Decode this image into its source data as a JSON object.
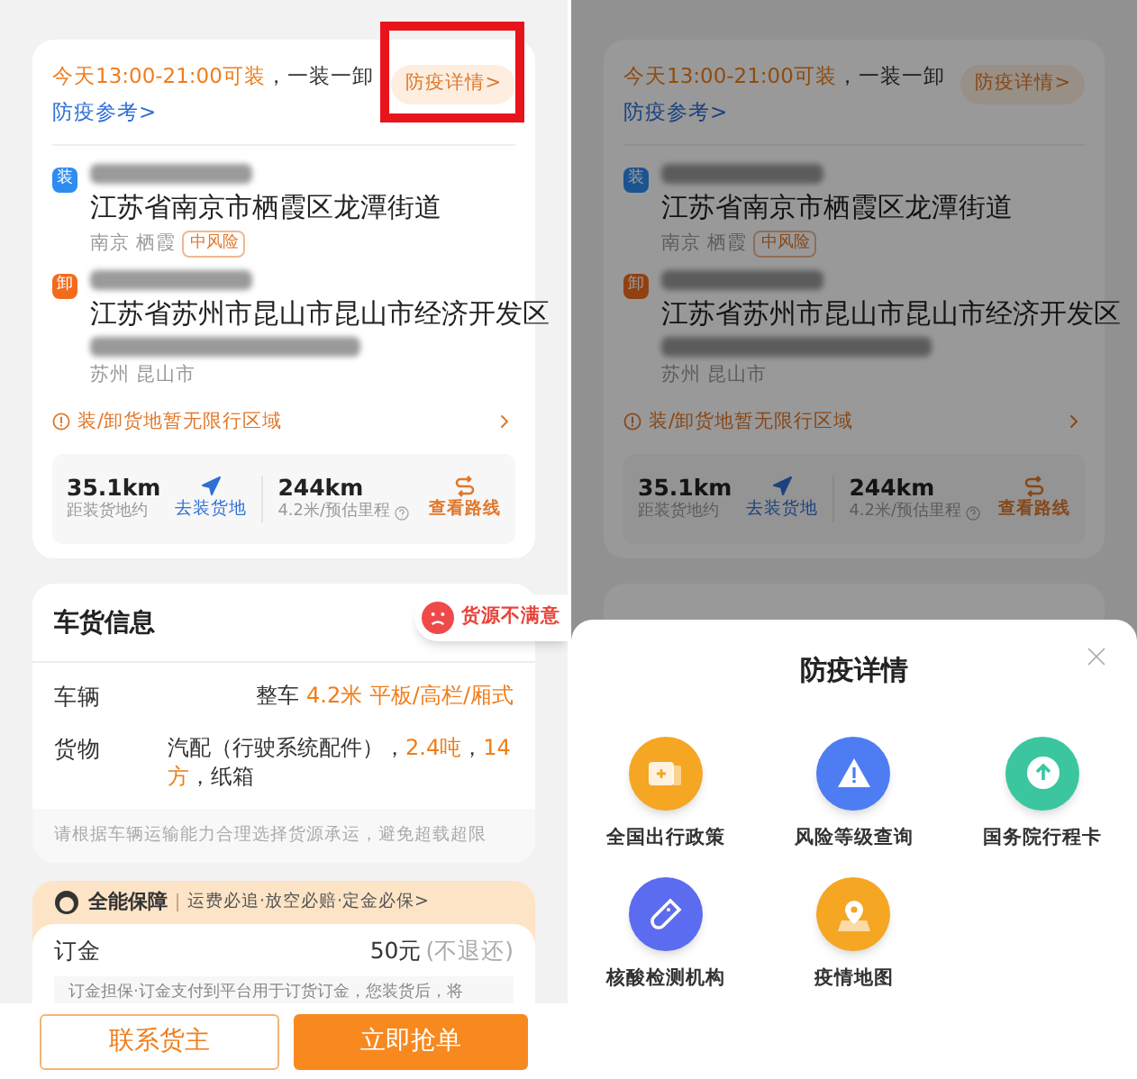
{
  "left_screen": {
    "dimmed": false,
    "header": {
      "time_text": "今天13:00-21:00可装",
      "plain_text": "，一装一卸 ",
      "link": "防疫参考>"
    },
    "epidemic_button": {
      "label": "防疫详情>",
      "highlighted": true
    },
    "stops": [
      {
        "kind": "load",
        "badge": "装",
        "address": "江苏省南京市栖霞区龙潭街道",
        "city": "南京 栖霞",
        "risk_tag": "中风险"
      },
      {
        "kind": "unload",
        "badge": "卸",
        "address": "江苏省苏州市昆山市昆山市经济开发区",
        "city": "苏州 昆山市"
      }
    ],
    "notice": "装/卸货地暂无限行区域",
    "stats": {
      "distance": "35.1km",
      "distance_label": "距装货地约",
      "nav_link": "去装货地",
      "mileage": "244km",
      "mileage_label": "4.2米/预估里程",
      "route_link": "查看路线"
    },
    "cargo": {
      "title": "车货信息",
      "feedback": "货源不满意",
      "rows": [
        {
          "label": "车辆",
          "parts": [
            {
              "text": "整车 ",
              "accent": false
            },
            {
              "text": "4.2米 平板/高栏/厢式",
              "accent": true
            }
          ]
        },
        {
          "label": "货物",
          "parts": [
            {
              "text": "汽配（行驶系统配件），",
              "accent": false
            },
            {
              "text": "2.4吨",
              "accent": true
            },
            {
              "text": "，",
              "accent": false
            },
            {
              "text": "14方",
              "accent": true
            },
            {
              "text": "，纸箱",
              "accent": false
            }
          ]
        }
      ],
      "tip": "请根据车辆运输能力合理选择货源承运，避免超载超限"
    },
    "guarantee": {
      "title": "全能保障",
      "detail": "运费必追·放空必赔·定金必保>"
    },
    "deposit": {
      "label": "订金",
      "amount": "50元",
      "note": "(不退还)",
      "description": "订金担保·订金支付到平台用于订货订金，您装货后，将"
    },
    "actions": [
      {
        "kind": "secondary",
        "label": "联系货主"
      },
      {
        "kind": "primary",
        "label": "立即抢单"
      }
    ]
  },
  "right_screen": {
    "dimmed": true,
    "header": {
      "time_text": "今天13:00-21:00可装",
      "plain_text": "，一装一卸 ",
      "link": "防疫参考>"
    },
    "epidemic_button": {
      "label": "防疫详情>",
      "highlighted": false
    },
    "stops": [
      {
        "kind": "load",
        "badge": "装",
        "address": "江苏省南京市栖霞区龙潭街道",
        "city": "南京 栖霞",
        "risk_tag": "中风险"
      },
      {
        "kind": "unload",
        "badge": "卸",
        "address": "江苏省苏州市昆山市昆山市经济开发区",
        "city": "苏州 昆山市"
      }
    ],
    "notice": "装/卸货地暂无限行区域",
    "stats": {
      "distance": "35.1km",
      "distance_label": "距装货地约",
      "nav_link": "去装货地",
      "mileage": "244km",
      "mileage_label": "4.2米/预估里程",
      "route_link": "查看路线"
    },
    "sheet": {
      "title": "防疫详情",
      "items": [
        {
          "kind": "policy",
          "label": "全国出行政策",
          "color": "#f5a623"
        },
        {
          "kind": "risk",
          "label": "风险等级查询",
          "color": "#4e7cf2"
        },
        {
          "kind": "trip",
          "label": "国务院行程卡",
          "color": "#3cc6a0"
        },
        {
          "kind": "test",
          "label": "核酸检测机构",
          "color": "#5b6cf0"
        },
        {
          "kind": "map",
          "label": "疫情地图",
          "color": "#f5a623"
        }
      ]
    }
  }
}
